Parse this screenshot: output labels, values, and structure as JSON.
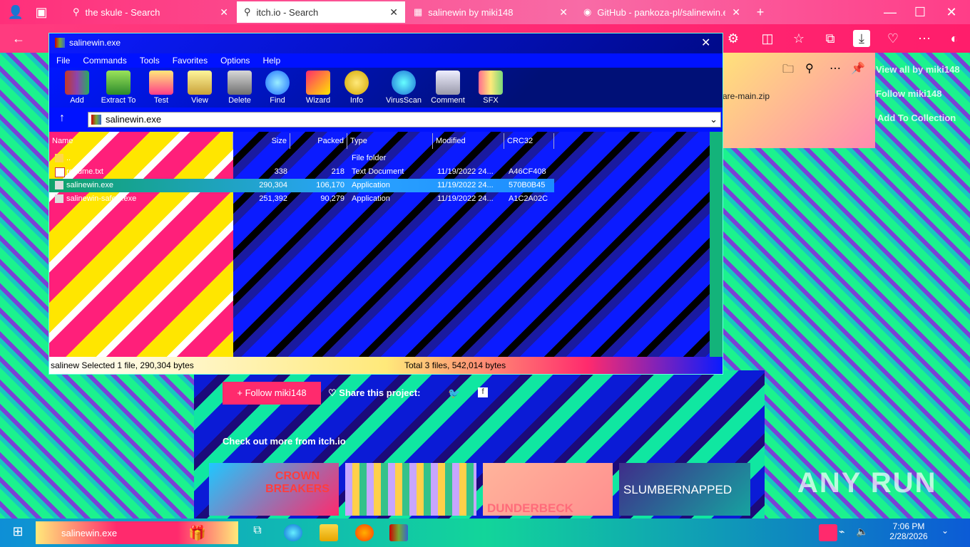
{
  "browser": {
    "tabs": [
      {
        "label": "the skule - Search",
        "active": false
      },
      {
        "label": "itch.io - Search",
        "active": true
      },
      {
        "label": "salinewin by miki148",
        "active": false
      },
      {
        "label": "GitHub - pankoza-pl/salinewin.e",
        "active": false
      }
    ],
    "new_tab": "+"
  },
  "downloads": {
    "file": "are-main.zip"
  },
  "sidebar_links": [
    "View all by miki148",
    "Follow miki148",
    "Add To Collection"
  ],
  "winrar": {
    "title": "salinewin.exe",
    "menu": [
      "File",
      "Commands",
      "Tools",
      "Favorites",
      "Options",
      "Help"
    ],
    "tools": [
      "Add",
      "Extract To",
      "Test",
      "View",
      "Delete",
      "Find",
      "Wizard",
      "Info",
      "VirusScan",
      "Comment",
      "SFX"
    ],
    "path": "salinewin.exe",
    "columns": [
      "Name",
      "Size",
      "Packed",
      "Type",
      "Modified",
      "CRC32"
    ],
    "rows": [
      {
        "name": "..",
        "size": "",
        "packed": "",
        "type": "File folder",
        "modified": "",
        "crc": ""
      },
      {
        "name": "readme.txt",
        "size": "338",
        "packed": "218",
        "type": "Text Document",
        "modified": "11/19/2022 24...",
        "crc": "A46CF408"
      },
      {
        "name": "salinewin.exe",
        "size": "290,304",
        "packed": "106,170",
        "type": "Application",
        "modified": "11/19/2022 24...",
        "crc": "570B0B45"
      },
      {
        "name": "salinewin-safety.exe",
        "size": "251,392",
        "packed": "90,279",
        "type": "Application",
        "modified": "11/19/2022 24...",
        "crc": "A1C2A02C"
      }
    ],
    "status_left": "salinew Selected 1 file, 290,304 bytes",
    "status_right": "Total 3 files, 542,014 bytes"
  },
  "page": {
    "follow": "Follow miki148",
    "share": "Share this project:",
    "more": "Check out more from itch.io",
    "thumbs": [
      "CROWN BREAKERS",
      "",
      "DUNDERBECK",
      "SLUMBERNAPPED"
    ]
  },
  "taskbar": {
    "active_app": "salinewin.exe",
    "time": "7:06 PM",
    "date": "2/28/2026"
  },
  "watermark": "ANY RUN"
}
